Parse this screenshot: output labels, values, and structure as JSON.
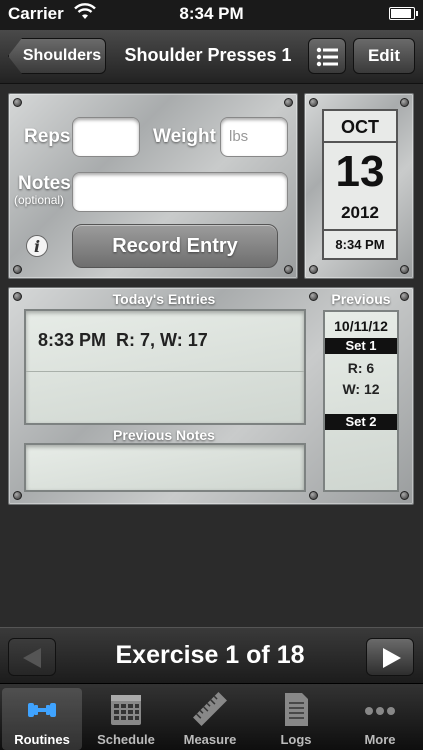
{
  "status": {
    "carrier": "Carrier",
    "time": "8:34 PM"
  },
  "nav": {
    "back_label": "Shoulders",
    "title": "Shoulder Presses 1",
    "edit_label": "Edit"
  },
  "entry_form": {
    "reps_label": "Reps",
    "weight_label": "Weight",
    "weight_placeholder": "lbs",
    "notes_label": "Notes",
    "notes_sub": "(optional)",
    "record_label": "Record Entry"
  },
  "calendar": {
    "month": "OCT",
    "day": "13",
    "year": "2012",
    "time": "8:34 PM"
  },
  "todays_entries": {
    "title": "Today's Entries",
    "entry_time": "8:33 PM",
    "entry_values": "R: 7, W: 17"
  },
  "previous_notes": {
    "title": "Previous Notes"
  },
  "previous": {
    "title": "Previous",
    "date": "10/11/12",
    "sets": [
      {
        "label": "Set 1",
        "reps": "R: 6",
        "weight": "W: 12"
      },
      {
        "label": "Set 2"
      }
    ]
  },
  "exercise_nav": {
    "label": "Exercise 1 of 18"
  },
  "tabs": [
    {
      "label": "Routines",
      "icon": "dumbbell-icon",
      "active": true
    },
    {
      "label": "Schedule",
      "icon": "calendar-icon"
    },
    {
      "label": "Measure",
      "icon": "ruler-icon"
    },
    {
      "label": "Logs",
      "icon": "document-icon"
    },
    {
      "label": "More",
      "icon": "more-dots-icon"
    }
  ]
}
